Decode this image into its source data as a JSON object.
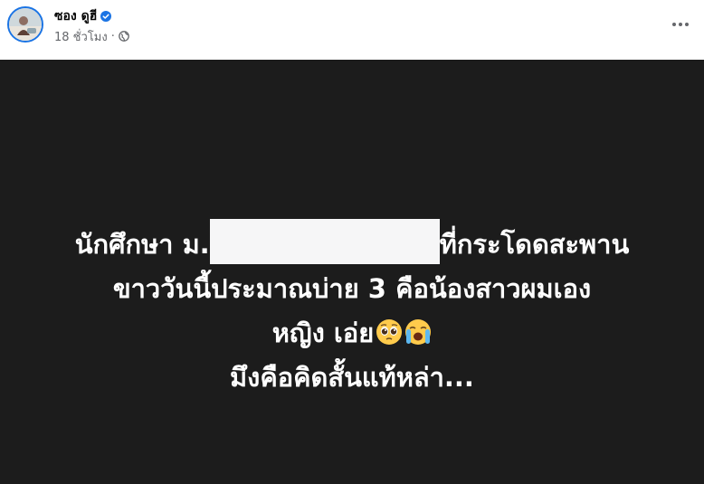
{
  "post": {
    "author": {
      "name": "ซอง ดูฮี"
    },
    "meta": {
      "time": "18 ชั่วโมง",
      "separator": "·"
    },
    "body": {
      "line1_start": "นักศึกษา ม.",
      "line1_end": "ที่กระโดดสะพาน",
      "line2": "ขาววันนี้ประมาณบ่าย 3 คือน้องสาวผมเอง",
      "line3": "หญิง เอ่ย",
      "line4": "มึงคือคิดสั้นแท้หล่า..."
    },
    "emojis": [
      "pleading-face",
      "loudly-crying-face"
    ]
  },
  "colors": {
    "background_post": "#1c1c1c",
    "text_post": "#ffffff",
    "accent": "#1b74e4",
    "meta_text": "#65676b"
  }
}
